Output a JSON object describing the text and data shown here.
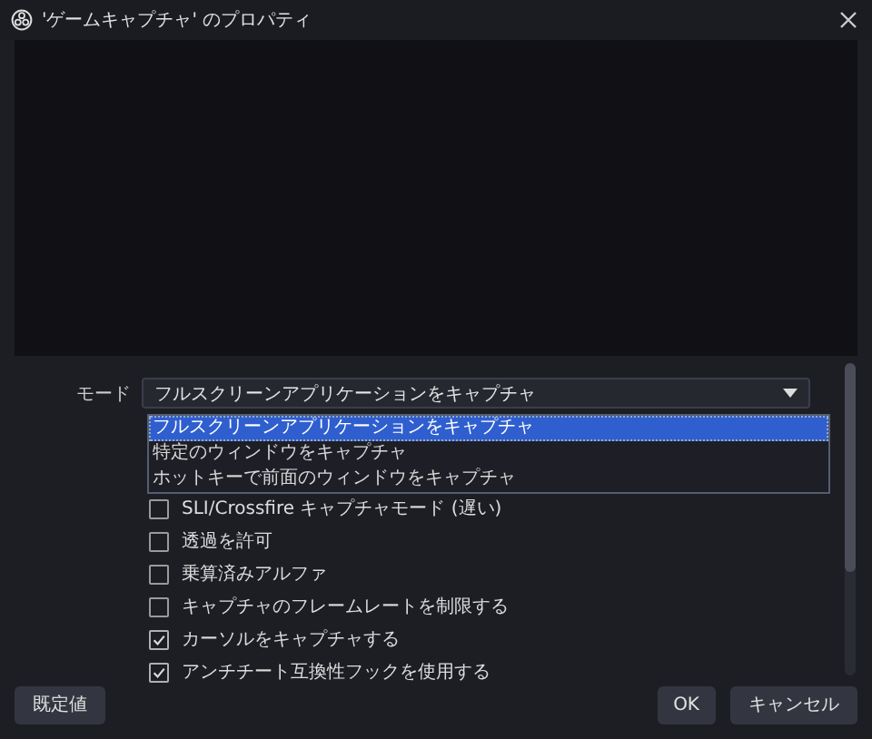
{
  "window": {
    "title": "'ゲームキャプチャ' のプロパティ"
  },
  "mode": {
    "label": "モード",
    "value": "フルスクリーンアプリケーションをキャプチャ",
    "options": [
      {
        "label": "フルスクリーンアプリケーションをキャプチャ",
        "selected": true
      },
      {
        "label": "特定のウィンドウをキャプチャ",
        "selected": false
      },
      {
        "label": "ホットキーで前面のウィンドウをキャプチャ",
        "selected": false
      }
    ]
  },
  "checkboxes": [
    {
      "label": "SLI/Crossfire キャプチャモード (遅い)",
      "checked": false
    },
    {
      "label": "透過を許可",
      "checked": false
    },
    {
      "label": "乗算済みアルファ",
      "checked": false
    },
    {
      "label": "キャプチャのフレームレートを制限する",
      "checked": false
    },
    {
      "label": "カーソルをキャプチャする",
      "checked": true
    },
    {
      "label": "アンチチート互換性フックを使用する",
      "checked": true
    }
  ],
  "buttons": {
    "defaults": "既定値",
    "ok": "OK",
    "cancel": "キャンセル"
  }
}
